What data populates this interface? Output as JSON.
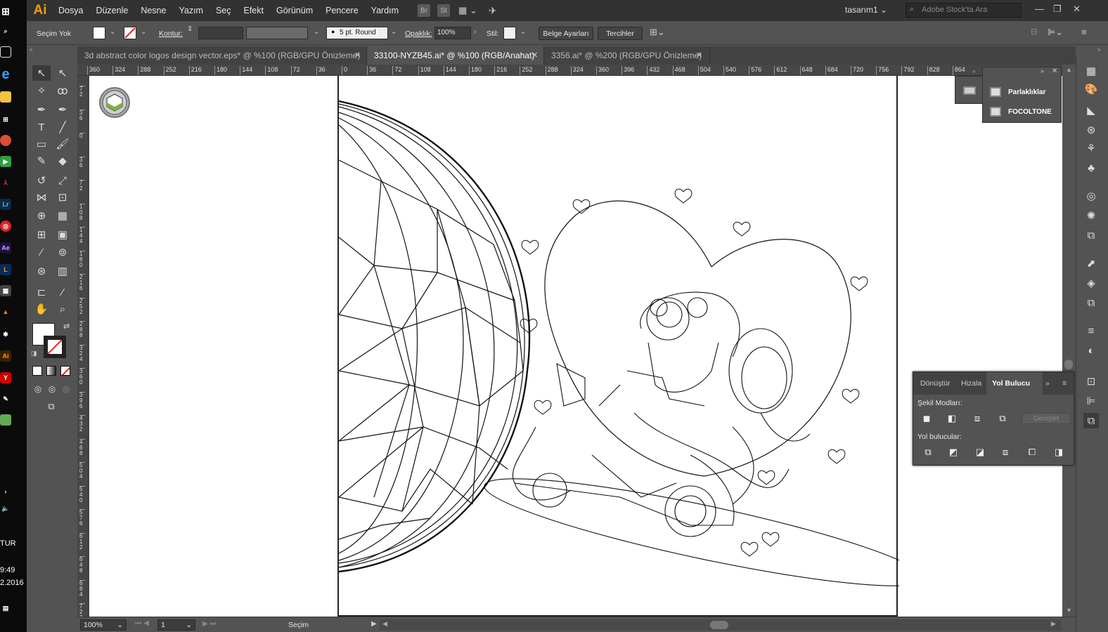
{
  "taskbar": {
    "lang": "TUR",
    "time": "9:49",
    "date": "2.2016",
    "icons": [
      "windows-icon",
      "search-icon",
      "task-view-icon",
      "edge-icon",
      "explorer-icon",
      "store-icon",
      "chrome-icon",
      "media-icon",
      "acrobat-icon",
      "lightroom-icon",
      "creative-cloud-icon",
      "after-effects-icon",
      "illustrator-icon",
      "calculator-icon",
      "vlc-icon",
      "game-icon",
      "yandex-icon",
      "paint-icon"
    ]
  },
  "menubar": {
    "logo": "Ai",
    "items": [
      "Dosya",
      "Düzenle",
      "Nesne",
      "Yazım",
      "Seç",
      "Efekt",
      "Görünüm",
      "Pencere",
      "Yardım"
    ],
    "bridge_badge": "Br",
    "stock_badge": "St",
    "workspace": "tasarım1",
    "search_placeholder": "Adobe Stock'ta Ara"
  },
  "controlbar": {
    "selection_label": "Seçim Yok",
    "stroke_label": "Kontur:",
    "brush_value": "5 pt. Round",
    "opacity_label": "Opaklık:",
    "opacity_value": "100%",
    "style_label": "Stil:",
    "doc_setup_button": "Belge Ayarları",
    "prefs_button": "Tercihler"
  },
  "tabs": [
    {
      "label": "3d abstract color logos design vector.eps* @ %100 (RGB/GPU Önizleme)",
      "active": false
    },
    {
      "label": "33100-NYZB45.ai* @ %100 (RGB/Anahat)",
      "active": true
    },
    {
      "label": "3356.ai* @ %200 (RGB/GPU Önizleme)",
      "active": false
    }
  ],
  "ruler_top_ticks": [
    "360",
    "324",
    "288",
    "252",
    "216",
    "180",
    "144",
    "108",
    "72",
    "36",
    "0",
    "36",
    "72",
    "108",
    "144",
    "180",
    "216",
    "252",
    "288",
    "324",
    "360",
    "396",
    "432",
    "468",
    "504",
    "540",
    "576",
    "612",
    "648",
    "684",
    "720",
    "756",
    "792",
    "828",
    "864"
  ],
  "ruler_left_ticks": [
    "72",
    "36",
    "0",
    "36",
    "72",
    "108",
    "144",
    "180",
    "216",
    "252",
    "288",
    "324",
    "360",
    "396",
    "432",
    "468",
    "504",
    "540",
    "576",
    "612",
    "648",
    "684",
    "720"
  ],
  "swatch_panel": {
    "items": [
      "Parlaklıklar",
      "FOCOLTONE"
    ]
  },
  "pathfinder": {
    "tabs": [
      "Dönüştür",
      "Hizala",
      "Yol Bulucu"
    ],
    "active_tab": "Yol Bulucu",
    "shape_modes_label": "Şekil Modları:",
    "pathfinders_label": "Yol bulucular:",
    "expand_button": "Genişlet"
  },
  "statusbar": {
    "zoom": "100%",
    "artboard": "1",
    "tool": "Seçim"
  },
  "colors": {
    "ui_bg": "#535353",
    "menubar": "#323232",
    "accent": "#ff9a00",
    "canvas": "#ffffff"
  }
}
